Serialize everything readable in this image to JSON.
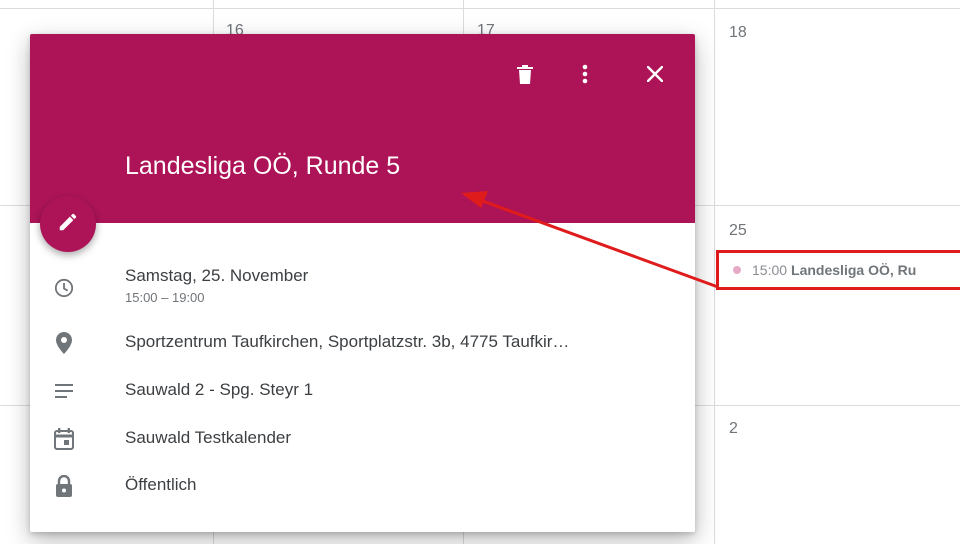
{
  "calendar": {
    "days": [
      {
        "label": "16"
      },
      {
        "label": "17"
      },
      {
        "label": "18"
      },
      {
        "label": "25"
      },
      {
        "label": "2"
      }
    ],
    "event": {
      "time": "15:00",
      "title": "Landesliga OÖ, Ru",
      "dot_color": "#e6a9c6"
    }
  },
  "popup": {
    "header_color": "#ad1457",
    "actions": [
      {
        "icon": "delete-icon"
      },
      {
        "icon": "more-vert-icon"
      },
      {
        "icon": "close-icon"
      }
    ],
    "edit_icon": "pencil-icon",
    "title": "Landesliga OÖ, Runde 5",
    "date": "Samstag, 25. November",
    "time": "15:00 – 19:00",
    "location": "Sportzentrum Taufkirchen, Sportplatzstr. 3b, 4775 Taufkir…",
    "description": "Sauwald 2 - Spg. Steyr 1",
    "calendar_name": "Sauwald Testkalender",
    "visibility": "Öffentlich",
    "row_icons": [
      "clock-icon",
      "location-pin-icon",
      "notes-icon",
      "calendar-icon",
      "lock-icon"
    ]
  },
  "annotation": {
    "color": "#e01b1b"
  }
}
